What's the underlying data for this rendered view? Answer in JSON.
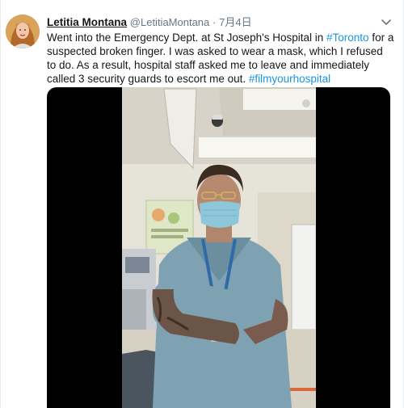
{
  "tweet": {
    "author_name": "Letitia Montana",
    "author_handle": "@LetitiaMontana",
    "separator": "·",
    "timestamp": "7月4日",
    "text_segments": [
      "Went into the Emergency Dept. at St Joseph's Hospital in ",
      "#Toronto",
      " for a suspected broken finger. I was asked to wear a mask, which I refused to do. As a result, hospital staff asked me to leave and immediately called 3 security guards to escort me out. ",
      "#filmyourhospital"
    ],
    "hashtags": [
      "#Toronto",
      "#filmyourhospital"
    ]
  },
  "icons": {
    "menu": "chevron-down-icon"
  },
  "colors": {
    "link": "#1b95e0",
    "secondary_text": "#657786",
    "primary_text": "#14171a",
    "scrubs": "#7fa2b3",
    "mask": "#8ec7d9"
  }
}
